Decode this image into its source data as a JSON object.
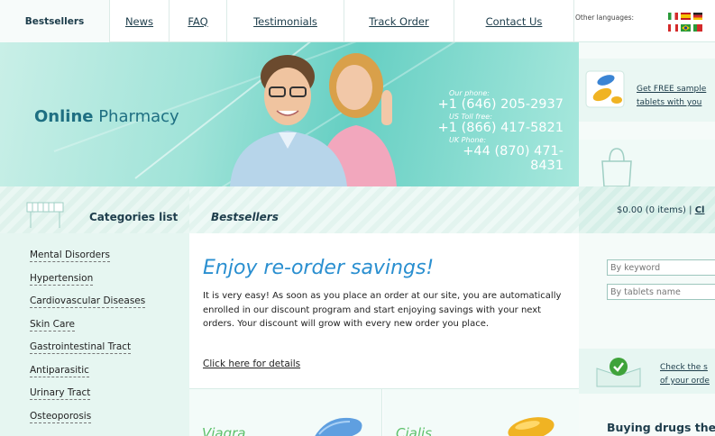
{
  "nav": {
    "tabs": [
      {
        "label": "Bestsellers",
        "active": true
      },
      {
        "label": "News",
        "active": false
      },
      {
        "label": "FAQ",
        "active": false
      },
      {
        "label": "Testimonials",
        "active": false
      },
      {
        "label": "Track Order",
        "active": false
      },
      {
        "label": "Contact Us",
        "active": false
      }
    ],
    "other_languages_label": "Other languages:",
    "flags": [
      "italy-flag",
      "spain-flag",
      "germany-flag",
      "canada-flag",
      "brazil-flag",
      "portugal-flag"
    ]
  },
  "banner": {
    "logo_bold": "Online",
    "logo_rest": " Pharmacy",
    "phones": [
      {
        "label": "Our phone:",
        "number": "+1 (646) 205-2937"
      },
      {
        "label": "US Toll free:",
        "number": "+1 (866) 417-5821"
      },
      {
        "label": "UK Phone:",
        "number": "+44 (870) 471-8431"
      }
    ]
  },
  "promo": {
    "line1": "Get FREE sample",
    "line2": "tablets with you"
  },
  "cart": {
    "summary": "$0.00 (0 items) | ",
    "link": "Cl"
  },
  "search": {
    "keyword_placeholder": "By keyword",
    "tablets_placeholder": "By tablets name"
  },
  "check": {
    "line1": "Check the s",
    "line2": "of your orde"
  },
  "buying_heading": "Buying drugs the",
  "categories": {
    "title": "Categories list",
    "items": [
      "Mental Disorders",
      "Hypertension",
      "Cardiovascular Diseases",
      "Skin Care",
      "Gastrointestinal Tract",
      "Antiparasitic",
      "Urinary Tract",
      "Osteoporosis"
    ]
  },
  "section_title": "Bestsellers",
  "reorder": {
    "title": "Enjoy re-order savings!",
    "body": "It is very easy! As soon as you place an order at our site, you are automatically enrolled in our discount program and start enjoying savings with your next orders. Your discount will grow with every new order you place.",
    "link": "Click here for details"
  },
  "products": [
    {
      "name": "Viagra"
    },
    {
      "name": "Cialis"
    }
  ],
  "colors": {
    "accent_blue": "#2a8fd0",
    "product_green": "#5cc06a",
    "banner_teal": "#66cfc3"
  }
}
